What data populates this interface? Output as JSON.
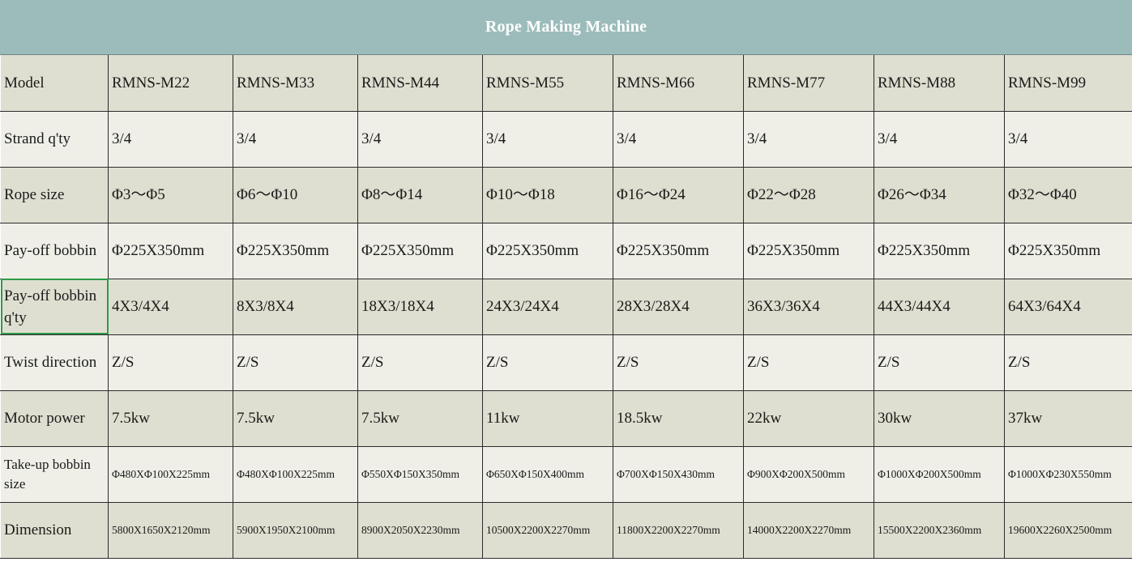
{
  "title": "Rope Making Machine",
  "rows": [
    {
      "label": "Model",
      "values": [
        "RMNS-M22",
        "RMNS-M33",
        "RMNS-M44",
        "RMNS-M55",
        "RMNS-M66",
        "RMNS-M77",
        "RMNS-M88",
        "RMNS-M99"
      ]
    },
    {
      "label": "Strand q'ty",
      "values": [
        "3/4",
        "3/4",
        "3/4",
        "3/4",
        "3/4",
        "3/4",
        "3/4",
        "3/4"
      ]
    },
    {
      "label": "Rope size",
      "values": [
        "Φ3～Φ5",
        "Φ6～Φ10",
        "Φ8～Φ14",
        "Φ10～Φ18",
        "Φ16～Φ24",
        "Φ22～Φ28",
        "Φ26～Φ34",
        "Φ32～Φ40"
      ]
    },
    {
      "label": "Pay-off bobbin",
      "values": [
        "Φ225X350mm",
        "Φ225X350mm",
        "Φ225X350mm",
        "Φ225X350mm",
        "Φ225X350mm",
        "Φ225X350mm",
        "Φ225X350mm",
        "Φ225X350mm"
      ]
    },
    {
      "label": "Pay-off bobbin q'ty",
      "values": [
        "4X3/4X4",
        "8X3/8X4",
        "18X3/18X4",
        "24X3/24X4",
        "28X3/28X4",
        "36X3/36X4",
        "44X3/44X4",
        "64X3/64X4"
      ]
    },
    {
      "label": "Twist direction",
      "values": [
        "Z/S",
        "Z/S",
        "Z/S",
        "Z/S",
        "Z/S",
        "Z/S",
        "Z/S",
        "Z/S"
      ]
    },
    {
      "label": "Motor power",
      "values": [
        "7.5kw",
        "7.5kw",
        "7.5kw",
        "11kw",
        "18.5kw",
        "22kw",
        "30kw",
        "37kw"
      ]
    },
    {
      "label": "Take-up bobbin size",
      "values": [
        "Φ480XΦ100X225mm",
        "Φ480XΦ100X225mm",
        "Φ550XΦ150X350mm",
        "Φ650XΦ150X400mm",
        "Φ700XΦ150X430mm",
        "Φ900XΦ200X500mm",
        "Φ1000XΦ200X500mm",
        "Φ1000XΦ230X550mm"
      ]
    },
    {
      "label": "Dimension",
      "values": [
        "5800X1650X2120mm",
        "5900X1950X2100mm",
        "8900X2050X2230mm",
        "10500X2200X2270mm",
        "11800X2200X2270mm",
        "14000X2200X2270mm",
        "15500X2200X2360mm",
        "19600X2260X2500mm"
      ]
    }
  ],
  "colors": {
    "header_bg": "#9cbcbb",
    "row_odd": "#dfdfd1",
    "row_even": "#efefe8",
    "selection": "#2e9a48"
  }
}
